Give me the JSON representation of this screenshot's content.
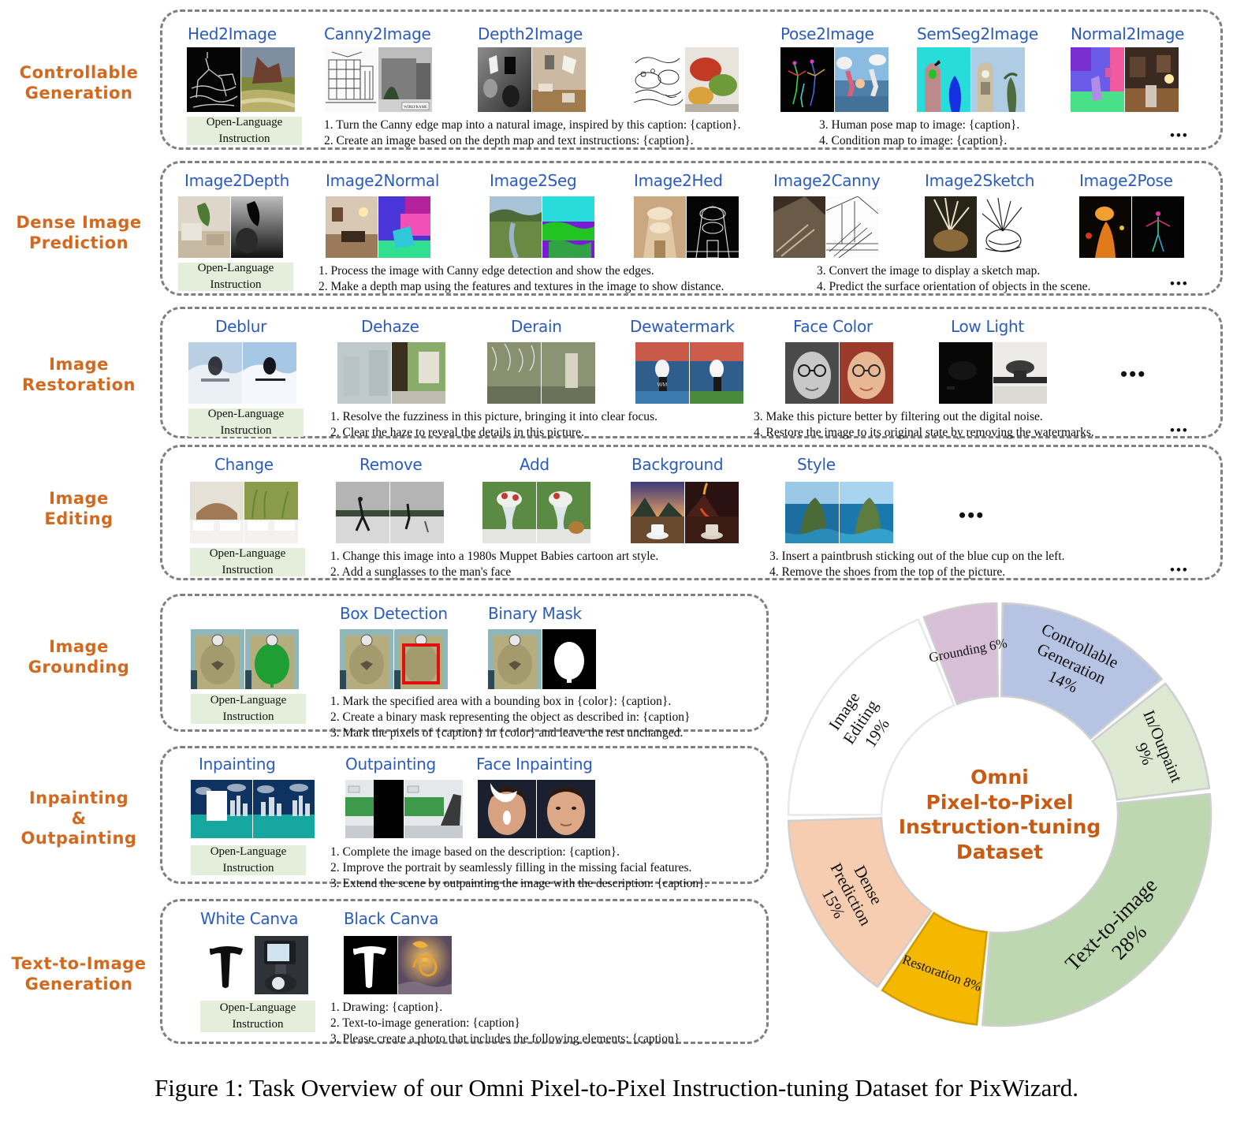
{
  "caption": "Figure 1: Task Overview of our Omni Pixel-to-Pixel Instruction-tuning Dataset for PixWizard.",
  "open_language": {
    "line1": "Open-Language",
    "line2": "Instruction"
  },
  "ellipsis": "•••",
  "ellipsis_small": "•••",
  "sections": [
    {
      "id": "controllable-generation",
      "label": "Controllable\nGeneration",
      "tasks": [
        "Hed2Image",
        "Canny2Image",
        "Depth2Image",
        "Pose2Image",
        "SemSeg2Image",
        "Normal2Image"
      ],
      "instructions": [
        "1.  Turn the Canny edge map into a natural image, inspired by this caption: {caption}.",
        "2.  Create an image based on the depth map and text instructions: {caption}.",
        "3.  Human pose map to image: {caption}.",
        "4.  Condition map to image: {caption}."
      ]
    },
    {
      "id": "dense-image-prediction",
      "label": "Dense Image\nPrediction",
      "tasks": [
        "Image2Depth",
        "Image2Normal",
        "Image2Seg",
        "Image2Hed",
        "Image2Canny",
        "Image2Sketch",
        "Image2Pose"
      ],
      "instructions": [
        "1.  Process the image with Canny edge detection and show the edges.",
        "2.  Make a depth map using the features and textures in the image to show distance.",
        "3.  Convert the image to display a sketch map.",
        "4.  Predict the surface orientation of objects in the scene."
      ]
    },
    {
      "id": "image-restoration",
      "label": "Image\nRestoration",
      "tasks": [
        "Deblur",
        "Dehaze",
        "Derain",
        "Dewatermark",
        "Face Color",
        "Low Light"
      ],
      "instructions": [
        "1.  Resolve the fuzziness in this picture, bringing it into clear focus.",
        "2.  Clear the haze to reveal the details in this picture.",
        "3.  Make this picture better by filtering out the digital noise.",
        "4.  Restore the image to its original state by removing the watermarks."
      ]
    },
    {
      "id": "image-editing",
      "label": "Image\nEditing",
      "tasks": [
        "Change",
        "Remove",
        "Add",
        "Background",
        "Style"
      ],
      "instructions": [
        "1.  Change this image into a 1980s Muppet Babies cartoon art style.",
        "2.  Add a sunglasses to the man's face",
        "3.  Insert a paintbrush sticking out of the blue cup on the left.",
        "4.  Remove the shoes from the top of the picture."
      ]
    },
    {
      "id": "image-grounding",
      "label": "Image\nGrounding",
      "tasks": [
        "Box Detection",
        "Binary Mask"
      ],
      "instructions": [
        "1.  Mark the specified area with a bounding box in {color}: {caption}.",
        "2.  Create a binary mask representing the object as described in: {caption}",
        "3.  Mark the pixels of {caption} in {color} and leave the rest unchanged."
      ]
    },
    {
      "id": "inpainting-outpainting",
      "label": "Inpainting\n&\nOutpainting",
      "tasks": [
        "Inpainting",
        "Outpainting",
        "Face Inpainting"
      ],
      "instructions": [
        "1.  Complete the image based on the description: {caption}.",
        "2.  Improve the portrait by seamlessly filling in the missing facial features.",
        "3.  Extend the scene by outpainting the image with the description: {caption}."
      ]
    },
    {
      "id": "text-to-image-generation",
      "label": "Text-to-Image\nGeneration",
      "tasks": [
        "White Canva",
        "Black Canva"
      ],
      "instructions": [
        "1.  Drawing: {caption}.",
        "2.  Text-to-image generation: {caption}",
        "3.  Please create a photo that includes the following elements: {caption}"
      ]
    }
  ],
  "chart_data": {
    "type": "pie",
    "title": "Omni Pixel-to-Pixel Instruction-tuning Dataset",
    "center_lines": [
      "Omni",
      "Pixel-to-Pixel",
      "Instruction-tuning",
      "Dataset"
    ],
    "legend": "none",
    "donut": true,
    "categories": [
      "Controllable Generation",
      "In/Outpaint",
      "Text-to-image",
      "Restoration",
      "Dense Prediction",
      "Image Editing",
      "Grounding"
    ],
    "values": [
      14,
      9,
      28,
      8,
      15,
      19,
      6
    ],
    "labels": [
      "Controllable Generation 14%",
      "In/Outpaint 9%",
      "Text-to-image 28%",
      "Restoration 8%",
      "Dense Prediction 15%",
      "Image Editing 19%",
      "Grounding 6%"
    ],
    "colors": [
      "#b6c3e2",
      "#dde9d3",
      "#bdd8b0",
      "#f5b800",
      "#f6cdb0",
      "#ffffff",
      "#d8bfd8"
    ],
    "slices": [
      {
        "name": "Controllable Generation",
        "value": 14,
        "color": "#b6c3e2",
        "label_lines": [
          "Controllable",
          "Generation",
          "14%"
        ]
      },
      {
        "name": "In/Outpaint",
        "value": 9,
        "color": "#dde9d3",
        "label_lines": [
          "In/Outpaint",
          "9%"
        ]
      },
      {
        "name": "Text-to-image",
        "value": 28,
        "color": "#bdd8b0",
        "label_lines": [
          "Text-to-image",
          "28%"
        ]
      },
      {
        "name": "Restoration",
        "value": 8,
        "color": "#f5b800",
        "label_lines": [
          "Restoration 8%"
        ]
      },
      {
        "name": "Dense Prediction",
        "value": 15,
        "color": "#f6cdb0",
        "label_lines": [
          "Dense",
          "Prediction",
          "15%"
        ]
      },
      {
        "name": "Image Editing",
        "value": 19,
        "color": "#ffffff",
        "label_lines": [
          "Image",
          "Editing",
          "19%"
        ]
      },
      {
        "name": "Grounding",
        "value": 6,
        "color": "#d8bfd8",
        "label_lines": [
          "Grounding 6%"
        ]
      }
    ]
  }
}
